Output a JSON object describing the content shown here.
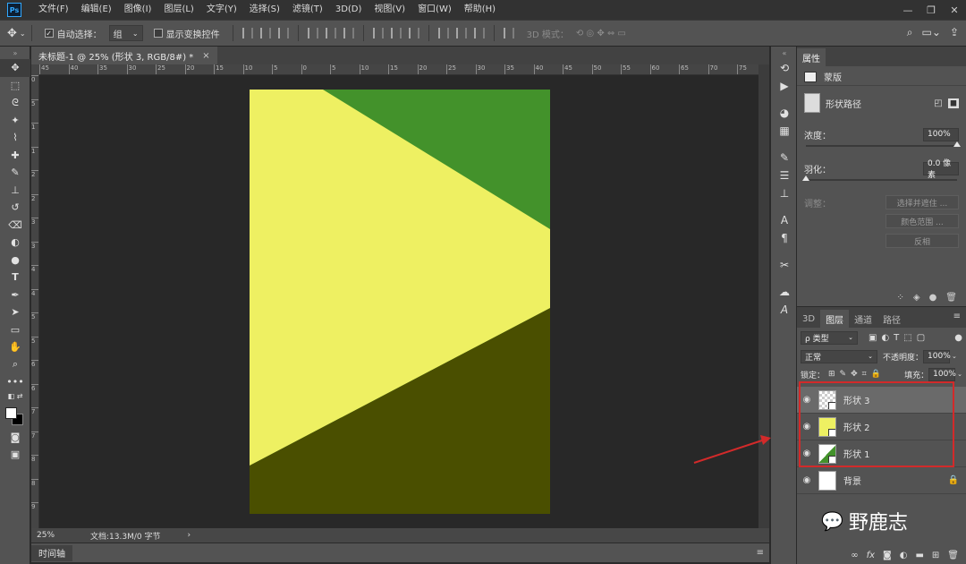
{
  "app": {
    "logo": "Ps"
  },
  "menu": [
    "文件(F)",
    "编辑(E)",
    "图像(I)",
    "图层(L)",
    "文字(Y)",
    "选择(S)",
    "滤镜(T)",
    "3D(D)",
    "视图(V)",
    "窗口(W)",
    "帮助(H)"
  ],
  "window_controls": {
    "minimize": "—",
    "restore": "❐",
    "close": "✕"
  },
  "options": {
    "move_icon": "move-icon",
    "auto_select_label": "自动选择：",
    "auto_select_checked": true,
    "auto_select_value": "组",
    "show_transform_label": "显示变换控件",
    "show_transform_checked": false,
    "mode_3d_label": "3D 模式："
  },
  "document": {
    "tab_title": "未标题-1 @ 25% (形状 3, RGB/8#) *",
    "close": "×",
    "zoom": "25%",
    "doc_info": "文档:13.3M/0 字节",
    "ruler_h": [
      "45",
      "40",
      "35",
      "30",
      "25",
      "20",
      "15",
      "10",
      "5",
      "0",
      "5",
      "10",
      "15",
      "20",
      "25",
      "30",
      "35",
      "40",
      "45",
      "50",
      "55",
      "60",
      "65",
      "70",
      "75"
    ],
    "ruler_v": [
      "0",
      "5",
      "1",
      "1",
      "2",
      "2",
      "3",
      "3",
      "4",
      "4",
      "5",
      "5",
      "6",
      "6",
      "7",
      "7",
      "8",
      "8",
      "9"
    ]
  },
  "artboard_colors": {
    "top_right": "#43922b",
    "bottom": "#4a4f00",
    "triangle": "#eef062"
  },
  "timeline": {
    "tab_label": "时间轴"
  },
  "properties": {
    "tab": "属性",
    "mask_type": "蒙版",
    "shape_path_label": "形状路径",
    "density_label": "浓度：",
    "density_value": "100%",
    "density_pct": 100,
    "feather_label": "羽化：",
    "feather_value": "0.0 像素",
    "adjust_label": "调整：",
    "select_refine": "选择并遮住 ...",
    "color_range": "颜色范围 ...",
    "invert": "反相"
  },
  "layers_panel": {
    "tabs": [
      "3D",
      "图层",
      "通道",
      "路径"
    ],
    "filter_label": "ρ 类型",
    "blend_mode": "正常",
    "opacity_label": "不透明度：",
    "opacity_value": "100%",
    "lock_label": "锁定：",
    "fill_label": "填充：",
    "fill_value": "100%",
    "layers": [
      {
        "name": "形状 3",
        "thumb_color": "#ffffff",
        "selected": true
      },
      {
        "name": "形状 2",
        "thumb_color": "#eef062",
        "selected": false
      },
      {
        "name": "形状 1",
        "thumb_color": "#43922b",
        "selected": false
      },
      {
        "name": "背景",
        "thumb_color": "#ffffff",
        "selected": false
      }
    ]
  },
  "watermark": {
    "text": "野鹿志"
  }
}
